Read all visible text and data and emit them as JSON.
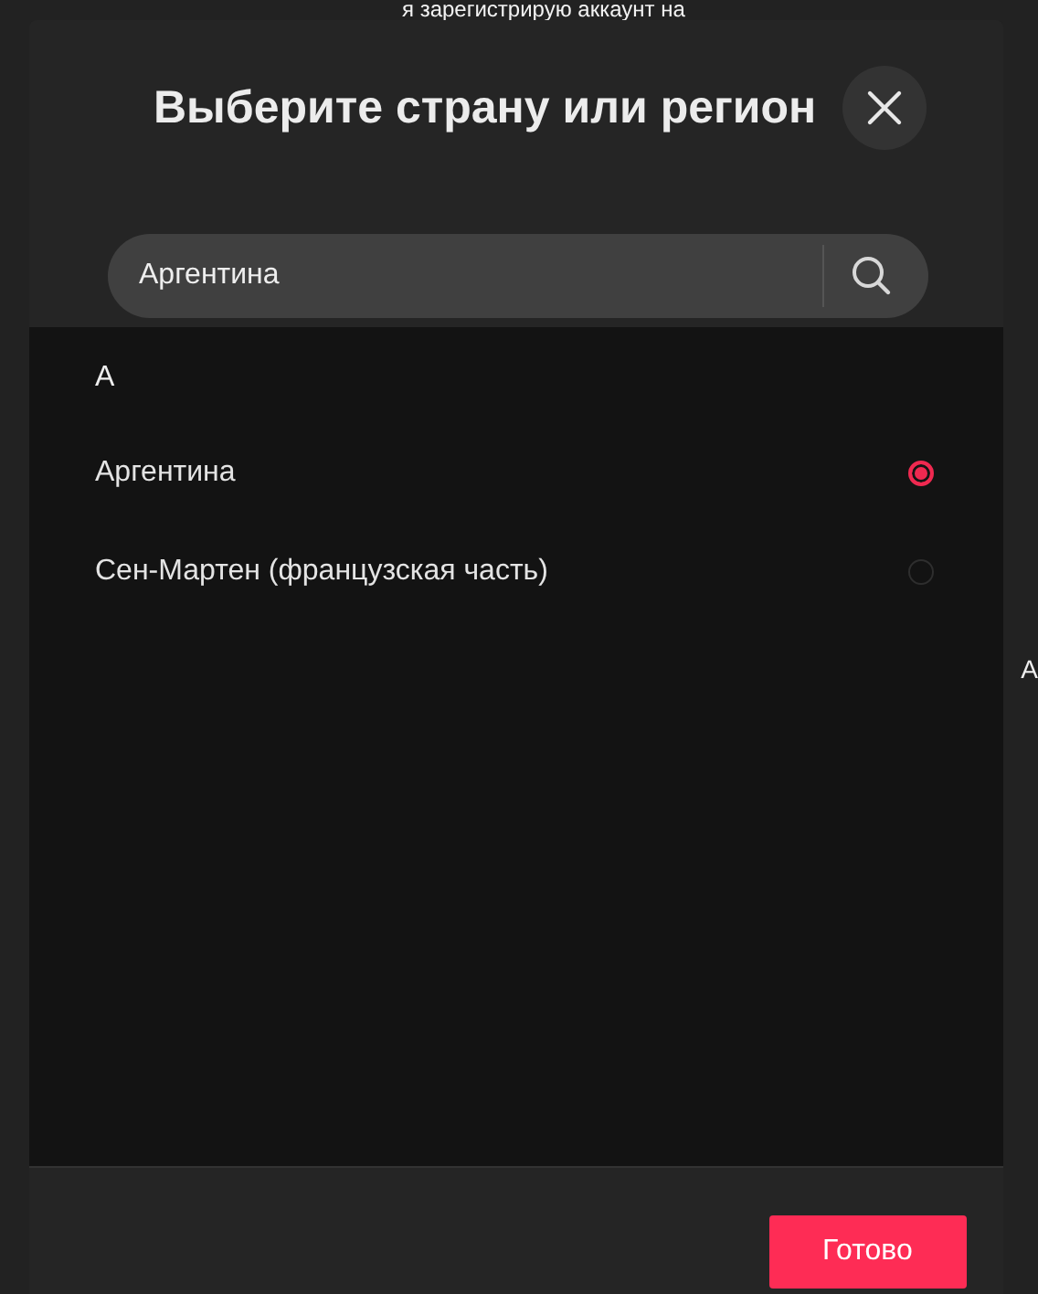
{
  "background_text": "я зарегистрирую аккаунт на",
  "side_text": "A",
  "dialog": {
    "title": "Выберите страну или регион",
    "search": {
      "value": "Аргентина"
    },
    "sections": [
      {
        "letter": "A",
        "items": [
          {
            "label": "Аргентина",
            "selected": true
          },
          {
            "label": "Сен-Мартен (французская часть)",
            "selected": false
          }
        ]
      }
    ],
    "done_button": "Готово"
  }
}
